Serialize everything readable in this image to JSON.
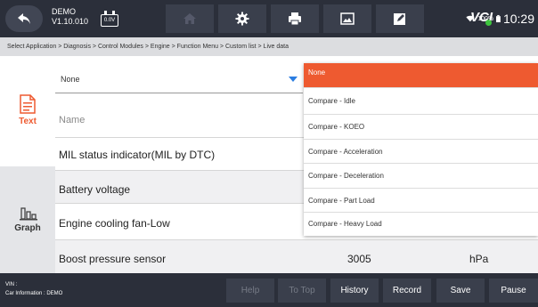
{
  "header": {
    "app_name": "DEMO",
    "version": "V1.10.010",
    "voltage": "0.0V",
    "vci_label": "VCI",
    "battery": "100%",
    "time": "10:29",
    "icons": [
      "back-arrow-icon",
      "home-icon",
      "gear-icon",
      "printer-icon",
      "image-icon",
      "edit-icon"
    ]
  },
  "breadcrumb": "Select Application > Diagnosis > Control Modules > Engine > Function Menu > Custom list > Live data",
  "sidebar": {
    "tabs": [
      {
        "label": "Text",
        "icon": "document-icon",
        "active": true
      },
      {
        "label": "Graph",
        "icon": "bar-chart-icon",
        "active": false
      }
    ]
  },
  "compare": {
    "selected": "None",
    "options": [
      "None",
      "Compare - Idle",
      "Compare - KOEO",
      "Compare - Acceleration",
      "Compare - Deceleration",
      "Compare - Part Load",
      "Compare - Heavy Load"
    ]
  },
  "table": {
    "name_header": "Name",
    "rows": [
      {
        "name": "MIL status indicator(MIL by DTC)",
        "value": "",
        "unit": ""
      },
      {
        "name": "Battery voltage",
        "value": "",
        "unit": ""
      },
      {
        "name": "Engine cooling fan-Low",
        "value": "",
        "unit": ""
      },
      {
        "name": "Boost pressure sensor",
        "value": "3005",
        "unit": "hPa"
      }
    ]
  },
  "footer": {
    "vin_label": "VIN :",
    "car_info": "Car Information : DEMO",
    "buttons": {
      "help": "Help",
      "to_top": "To Top",
      "history": "History",
      "record": "Record",
      "save": "Save",
      "pause": "Pause"
    }
  },
  "colors": {
    "topbar": "#2b2f3a",
    "accent_selected": "#ee5a30",
    "caret": "#2b7de1",
    "vci_status": "#3ec43e"
  }
}
